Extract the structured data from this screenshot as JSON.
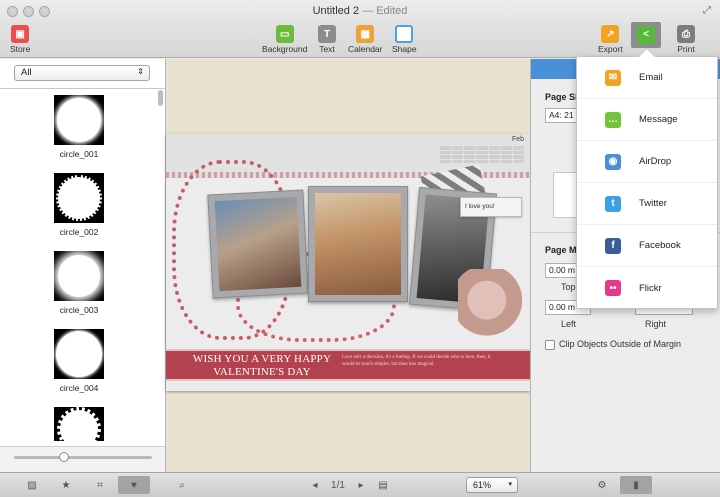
{
  "window": {
    "title": "Untitled 2",
    "title_status": "— Edited"
  },
  "toolbar": {
    "store_label": "Store",
    "background_label": "Background",
    "text_label": "Text",
    "calendar_label": "Calendar",
    "shape_label": "Shape",
    "export_label": "Export",
    "print_label": "Print",
    "colors": {
      "store": "#e8514b",
      "background": "#6dbb3a",
      "text": "#8c8c8c",
      "calendar": "#f0a23a",
      "shape": "#4aa0e0",
      "export": "#f3a324",
      "share": "#58b83c",
      "print": "#7d7d7d"
    }
  },
  "sidebar": {
    "filter_value": "All",
    "items": [
      {
        "label": "circle_001"
      },
      {
        "label": "circle_002"
      },
      {
        "label": "circle_003"
      },
      {
        "label": "circle_004"
      },
      {
        "label": ""
      }
    ],
    "thumb_size_fraction": 0.35
  },
  "canvas": {
    "calendar_month": "Feb",
    "note_text": "I love you!",
    "headline": "WISH YOU A VERY HAPPY VALENTINE'S DAY",
    "poem": "Love isn't a decision, it's a feeling. If we could decide who to love, then, it would be much simpler, but then less magical."
  },
  "inspector": {
    "page_size_label": "Page Si",
    "page_size_value": "A4: 21",
    "page_margin_label": "Page M",
    "margin_top_value": "0.00 m",
    "margin_top_caption": "Top",
    "margin_left_value": "0.00 m",
    "margin_left_caption": "Left",
    "margin_right_caption": "Right",
    "clip_label": "Clip Objects Outside of Margin"
  },
  "share_menu": {
    "items": [
      {
        "label": "Email",
        "icon": "email-icon",
        "color": "#f3a324",
        "glyph": "✉"
      },
      {
        "label": "Message",
        "icon": "message-icon",
        "color": "#71c43b",
        "glyph": "…"
      },
      {
        "label": "AirDrop",
        "icon": "airdrop-icon",
        "color": "#4a90d9",
        "glyph": "◉"
      },
      {
        "label": "Twitter",
        "icon": "twitter-icon",
        "color": "#3aa2e3",
        "glyph": "t"
      },
      {
        "label": "Facebook",
        "icon": "facebook-icon",
        "color": "#3b5b9a",
        "glyph": "f"
      },
      {
        "label": "Flickr",
        "icon": "flickr-icon",
        "color": "#e53a8c",
        "glyph": "••"
      }
    ]
  },
  "bottombar": {
    "page_indicator": "1/1",
    "zoom_value": "61%"
  }
}
